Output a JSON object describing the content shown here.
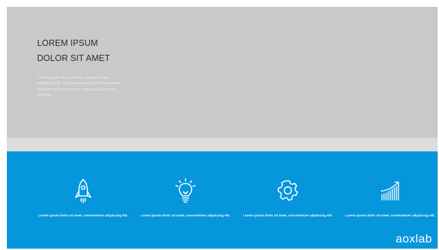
{
  "hero": {
    "title": "LOREM IPSUM\nDOLOR SIT AMET",
    "body": "Lorem ipsum dolor sit amet, consec tetuer adipiscing elit, sed diam nonummy nibh euismod tincidunt ut laoreet dolore magna aliquam erat volutpat."
  },
  "features": [
    {
      "icon": "rocket-icon",
      "caption": "Lorem ipsum dolor sit amet, consectetuer adipiscing elit."
    },
    {
      "icon": "lightbulb-icon",
      "caption": "Lorem ipsum dolor sit amet, consectetuer adipiscing elit."
    },
    {
      "icon": "gear-icon",
      "caption": "Lorem ipsum dolor sit amet, consectetuer adipiscing elit."
    },
    {
      "icon": "growth-chart-icon",
      "caption": "Lorem ipsum dolor sit amet, consectetuer adipiscing elit."
    }
  ],
  "brand": "aoxlab",
  "colors": {
    "hero_bg": "#c9c9c9",
    "band_bg": "#dcdcdc",
    "accent_blue": "#0596dc",
    "title_text": "#2b2b2b",
    "on_accent": "#ffffff"
  }
}
